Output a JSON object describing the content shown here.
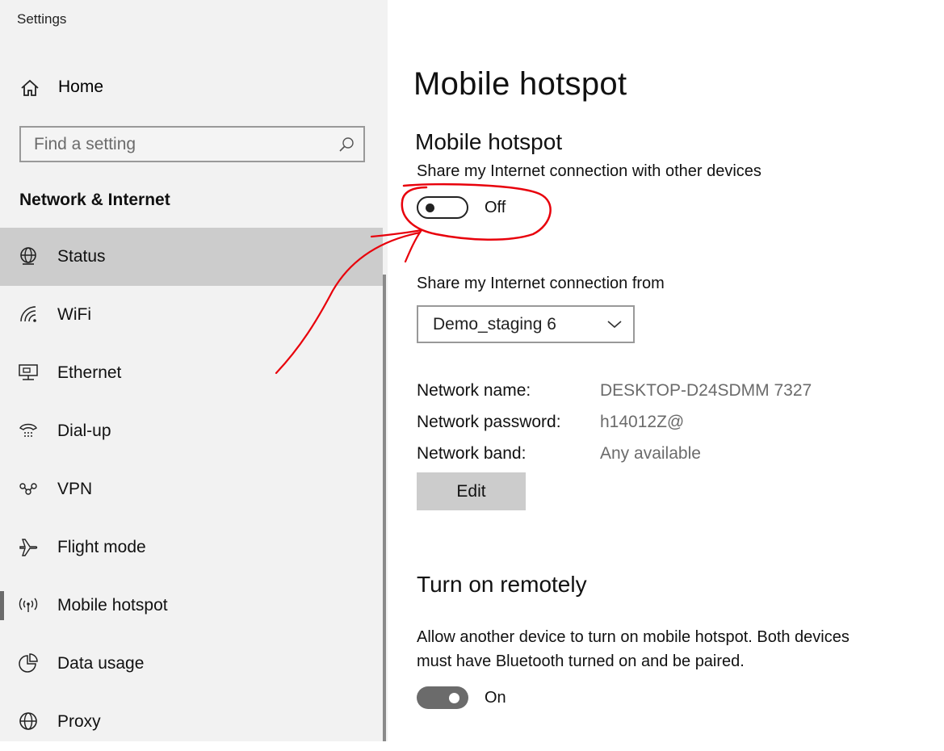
{
  "app": {
    "title": "Settings"
  },
  "sidebar": {
    "home_label": "Home",
    "search": {
      "placeholder": "Find a setting",
      "value": ""
    },
    "section_title": "Network & Internet",
    "items": [
      {
        "label": "Status",
        "icon": "globe-icon",
        "selected": true
      },
      {
        "label": "WiFi",
        "icon": "wifi-icon"
      },
      {
        "label": "Ethernet",
        "icon": "ethernet-icon"
      },
      {
        "label": "Dial-up",
        "icon": "dialup-icon"
      },
      {
        "label": "VPN",
        "icon": "vpn-icon"
      },
      {
        "label": "Flight mode",
        "icon": "airplane-icon"
      },
      {
        "label": "Mobile hotspot",
        "icon": "hotspot-icon",
        "current": true
      },
      {
        "label": "Data usage",
        "icon": "pie-chart-icon"
      },
      {
        "label": "Proxy",
        "icon": "globe-icon"
      }
    ]
  },
  "main": {
    "page_title": "Mobile hotspot",
    "hotspot": {
      "heading": "Mobile hotspot",
      "description": "Share my Internet connection with other devices",
      "toggle_state": "Off"
    },
    "share_from": {
      "label": "Share my Internet connection from",
      "selected": "Demo_staging 6"
    },
    "network": {
      "name_label": "Network name:",
      "name_value": "DESKTOP-D24SDMM 7327",
      "password_label": "Network password:",
      "password_value": "h14012Z@",
      "band_label": "Network band:",
      "band_value": "Any available",
      "edit_label": "Edit"
    },
    "remote": {
      "heading": "Turn on remotely",
      "description_line1": "Allow another device to turn on mobile hotspot. Both devices",
      "description_line2": "must have Bluetooth turned on and be paired.",
      "toggle_state": "On"
    }
  },
  "colors": {
    "sidebar_bg": "#f2f2f2",
    "selected_bg": "#cccccc",
    "annotation": "#e8000b",
    "secondary_text": "#6b6b6b"
  }
}
